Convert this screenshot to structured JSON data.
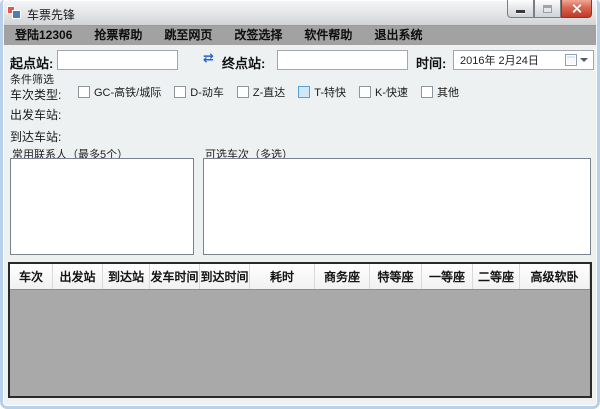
{
  "window": {
    "title": "车票先锋"
  },
  "menu": {
    "items": [
      {
        "id": "login-12306",
        "label": "登陆12306"
      },
      {
        "id": "grab-help",
        "label": "抢票帮助"
      },
      {
        "id": "goto-web",
        "label": "跳至网页"
      },
      {
        "id": "rebook-select",
        "label": "改签选择"
      },
      {
        "id": "software-help",
        "label": "软件帮助"
      },
      {
        "id": "exit-system",
        "label": "退出系统"
      }
    ]
  },
  "search": {
    "origin_label": "起点站:",
    "origin_value": "",
    "destination_label": "终点站:",
    "destination_value": "",
    "time_label": "时间:",
    "date_value": "2016年 2月24日"
  },
  "icons": {
    "swap_glyph": "⇄"
  },
  "filter": {
    "section_label": "条件筛选",
    "train_type_label": "车次类型:",
    "train_types": [
      {
        "id": "gc-highspeed",
        "label": "GC-高铁/城际",
        "checked": false,
        "highlighted": false
      },
      {
        "id": "d-emu",
        "label": "D-动车",
        "checked": false,
        "highlighted": false
      },
      {
        "id": "z-direct",
        "label": "Z-直达",
        "checked": false,
        "highlighted": false
      },
      {
        "id": "t-express",
        "label": "T-特快",
        "checked": false,
        "highlighted": true
      },
      {
        "id": "k-fast",
        "label": "K-快速",
        "checked": false,
        "highlighted": false
      },
      {
        "id": "other",
        "label": "其他",
        "checked": false,
        "highlighted": false
      }
    ],
    "departure_station_label": "出发车站:",
    "arrival_station_label": "到达车站:"
  },
  "lists": {
    "contacts_label": "常用联系人（最多5个）",
    "contacts": [],
    "trains_label": "可选车次（多选）",
    "trains": []
  },
  "table": {
    "columns": [
      "车次",
      "出发站",
      "到达站",
      "发车时间",
      "到达时间",
      "耗时",
      "商务座",
      "特等座",
      "一等座",
      "二等座",
      "高级软卧"
    ],
    "rows": []
  },
  "colors": {
    "frame": "#b9d0ea",
    "menu_bg": "#a2a2a2",
    "client_bg": "#eef1f2",
    "grid_empty_bg": "#a9a9a9",
    "close_button": "#c0392b",
    "highlight_checkbox": "#cfe7f7",
    "swap_icon": "#2b63cc"
  }
}
